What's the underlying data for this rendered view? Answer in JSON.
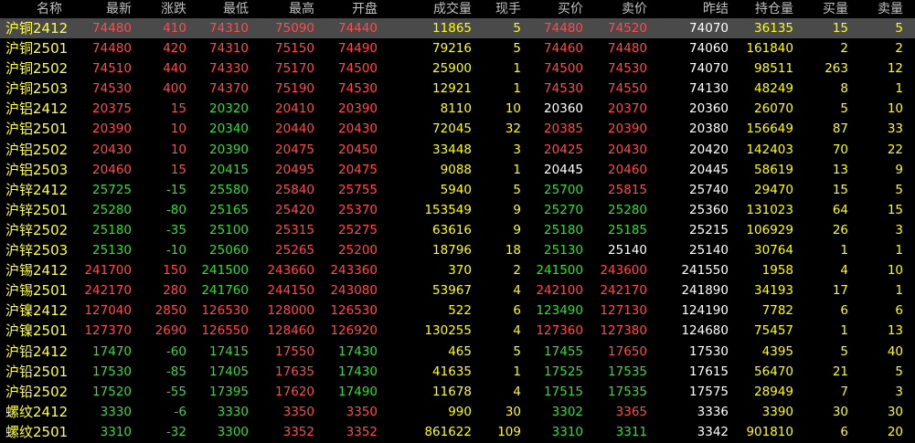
{
  "headers": [
    "名称",
    "最新",
    "涨跌",
    "最低",
    "最高",
    "开盘",
    "成交量",
    "现手",
    "买价",
    "卖价",
    "昨结",
    "持仓量",
    "买量",
    "卖量"
  ],
  "colors": {
    "up": "#ff4a4a",
    "down": "#33dd33",
    "flat": "#ffffff",
    "name": "#ffff44",
    "yellow": "#ffff00",
    "header": "#c0c0c0",
    "selected_bg": "#4a4a4a"
  },
  "rows": [
    {
      "name": "沪铜2412",
      "last": "74480",
      "change": "410",
      "low": "74310",
      "high": "75090",
      "open": "74440",
      "volume": "11865",
      "lot": "5",
      "bid": "74480",
      "ask": "74520",
      "prev_settle": "74070",
      "oi": "36135",
      "bid_vol": "15",
      "ask_vol": "5"
    },
    {
      "name": "沪铜2501",
      "last": "74480",
      "change": "420",
      "low": "74310",
      "high": "75150",
      "open": "74490",
      "volume": "79216",
      "lot": "5",
      "bid": "74460",
      "ask": "74480",
      "prev_settle": "74060",
      "oi": "161840",
      "bid_vol": "2",
      "ask_vol": "2"
    },
    {
      "name": "沪铜2502",
      "last": "74510",
      "change": "440",
      "low": "74330",
      "high": "75170",
      "open": "74500",
      "volume": "25900",
      "lot": "1",
      "bid": "74500",
      "ask": "74530",
      "prev_settle": "74070",
      "oi": "98511",
      "bid_vol": "263",
      "ask_vol": "12"
    },
    {
      "name": "沪铜2503",
      "last": "74530",
      "change": "400",
      "low": "74370",
      "high": "75190",
      "open": "74530",
      "volume": "12921",
      "lot": "1",
      "bid": "74530",
      "ask": "74550",
      "prev_settle": "74130",
      "oi": "48249",
      "bid_vol": "8",
      "ask_vol": "1"
    },
    {
      "name": "沪铝2412",
      "last": "20375",
      "change": "15",
      "low": "20320",
      "high": "20410",
      "open": "20390",
      "volume": "8110",
      "lot": "10",
      "bid": "20360",
      "ask": "20370",
      "prev_settle": "20360",
      "oi": "26070",
      "bid_vol": "5",
      "ask_vol": "10"
    },
    {
      "name": "沪铝2501",
      "last": "20390",
      "change": "10",
      "low": "20340",
      "high": "20440",
      "open": "20430",
      "volume": "72045",
      "lot": "32",
      "bid": "20385",
      "ask": "20390",
      "prev_settle": "20380",
      "oi": "156649",
      "bid_vol": "87",
      "ask_vol": "33"
    },
    {
      "name": "沪铝2502",
      "last": "20430",
      "change": "10",
      "low": "20390",
      "high": "20475",
      "open": "20450",
      "volume": "33448",
      "lot": "3",
      "bid": "20425",
      "ask": "20430",
      "prev_settle": "20420",
      "oi": "142403",
      "bid_vol": "70",
      "ask_vol": "22"
    },
    {
      "name": "沪铝2503",
      "last": "20460",
      "change": "15",
      "low": "20415",
      "high": "20495",
      "open": "20475",
      "volume": "9088",
      "lot": "1",
      "bid": "20445",
      "ask": "20460",
      "prev_settle": "20445",
      "oi": "58619",
      "bid_vol": "13",
      "ask_vol": "9"
    },
    {
      "name": "沪锌2412",
      "last": "25725",
      "change": "-15",
      "low": "25580",
      "high": "25840",
      "open": "25755",
      "volume": "5940",
      "lot": "5",
      "bid": "25700",
      "ask": "25815",
      "prev_settle": "25740",
      "oi": "29470",
      "bid_vol": "15",
      "ask_vol": "5"
    },
    {
      "name": "沪锌2501",
      "last": "25280",
      "change": "-80",
      "low": "25165",
      "high": "25420",
      "open": "25370",
      "volume": "153549",
      "lot": "9",
      "bid": "25270",
      "ask": "25280",
      "prev_settle": "25360",
      "oi": "131023",
      "bid_vol": "64",
      "ask_vol": "15"
    },
    {
      "name": "沪锌2502",
      "last": "25180",
      "change": "-35",
      "low": "25100",
      "high": "25315",
      "open": "25275",
      "volume": "63616",
      "lot": "9",
      "bid": "25180",
      "ask": "25185",
      "prev_settle": "25215",
      "oi": "106929",
      "bid_vol": "26",
      "ask_vol": "3"
    },
    {
      "name": "沪锌2503",
      "last": "25130",
      "change": "-10",
      "low": "25060",
      "high": "25265",
      "open": "25200",
      "volume": "18796",
      "lot": "18",
      "bid": "25130",
      "ask": "25140",
      "prev_settle": "25140",
      "oi": "30764",
      "bid_vol": "1",
      "ask_vol": "1"
    },
    {
      "name": "沪锡2412",
      "last": "241700",
      "change": "150",
      "low": "241500",
      "high": "243660",
      "open": "243360",
      "volume": "370",
      "lot": "2",
      "bid": "241500",
      "ask": "243600",
      "prev_settle": "241550",
      "oi": "1958",
      "bid_vol": "4",
      "ask_vol": "10"
    },
    {
      "name": "沪锡2501",
      "last": "242170",
      "change": "280",
      "low": "241760",
      "high": "244150",
      "open": "243080",
      "volume": "53967",
      "lot": "4",
      "bid": "242100",
      "ask": "242170",
      "prev_settle": "241890",
      "oi": "34193",
      "bid_vol": "17",
      "ask_vol": "1"
    },
    {
      "name": "沪镍2412",
      "last": "127040",
      "change": "2850",
      "low": "126530",
      "high": "128000",
      "open": "126530",
      "volume": "522",
      "lot": "6",
      "bid": "123490",
      "ask": "127130",
      "prev_settle": "124190",
      "oi": "7782",
      "bid_vol": "6",
      "ask_vol": "6"
    },
    {
      "name": "沪镍2501",
      "last": "127370",
      "change": "2690",
      "low": "126550",
      "high": "128460",
      "open": "126920",
      "volume": "130255",
      "lot": "4",
      "bid": "127360",
      "ask": "127380",
      "prev_settle": "124680",
      "oi": "75457",
      "bid_vol": "1",
      "ask_vol": "13"
    },
    {
      "name": "沪铅2412",
      "last": "17470",
      "change": "-60",
      "low": "17415",
      "high": "17550",
      "open": "17430",
      "volume": "465",
      "lot": "5",
      "bid": "17455",
      "ask": "17650",
      "prev_settle": "17530",
      "oi": "4395",
      "bid_vol": "5",
      "ask_vol": "40"
    },
    {
      "name": "沪铅2501",
      "last": "17530",
      "change": "-85",
      "low": "17405",
      "high": "17635",
      "open": "17430",
      "volume": "41635",
      "lot": "1",
      "bid": "17525",
      "ask": "17535",
      "prev_settle": "17615",
      "oi": "56470",
      "bid_vol": "21",
      "ask_vol": "5"
    },
    {
      "name": "沪铅2502",
      "last": "17520",
      "change": "-55",
      "low": "17395",
      "high": "17620",
      "open": "17490",
      "volume": "11678",
      "lot": "4",
      "bid": "17515",
      "ask": "17535",
      "prev_settle": "17575",
      "oi": "28949",
      "bid_vol": "7",
      "ask_vol": "3"
    },
    {
      "name": "螺纹2412",
      "last": "3330",
      "change": "-6",
      "low": "3330",
      "high": "3350",
      "open": "3350",
      "volume": "990",
      "lot": "30",
      "bid": "3302",
      "ask": "3365",
      "prev_settle": "3336",
      "oi": "3390",
      "bid_vol": "30",
      "ask_vol": "30"
    },
    {
      "name": "螺纹2501",
      "last": "3310",
      "change": "-32",
      "low": "3300",
      "high": "3352",
      "open": "3352",
      "volume": "861622",
      "lot": "109",
      "bid": "3310",
      "ask": "3311",
      "prev_settle": "3342",
      "oi": "901810",
      "bid_vol": "6",
      "ask_vol": "20"
    }
  ]
}
